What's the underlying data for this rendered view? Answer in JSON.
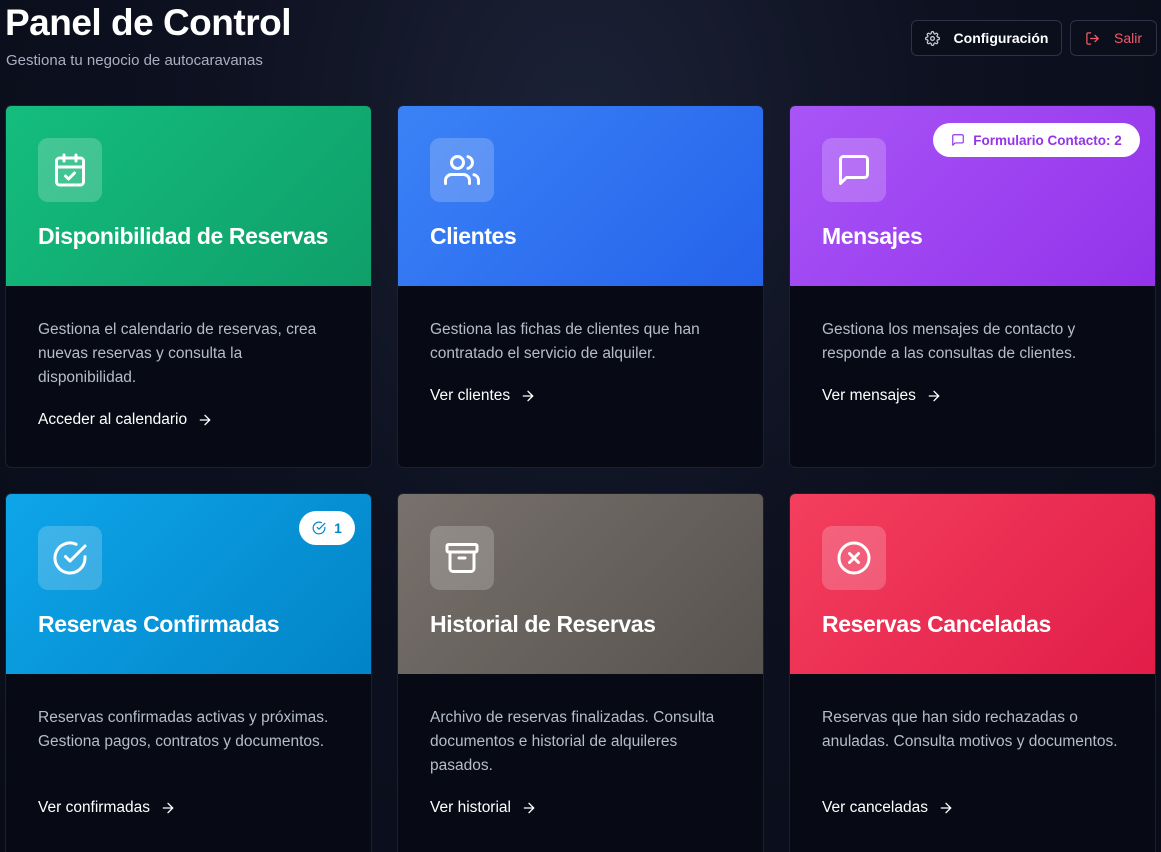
{
  "header": {
    "title": "Panel de Control",
    "subtitle": "Gestiona tu negocio de autocaravanas",
    "config_label": "Configuración",
    "exit_label": "Salir"
  },
  "cards": [
    {
      "title": "Disponibilidad de Reservas",
      "description": "Gestiona el calendario de reservas, crea nuevas reservas y consulta la disponibilidad.",
      "link": "Acceder al calendario",
      "icon": "calendar-check-icon",
      "color": "#16b57a"
    },
    {
      "title": "Clientes",
      "description": "Gestiona las fichas de clientes que han contratado el servicio de alquiler.",
      "link": "Ver clientes",
      "icon": "users-icon",
      "color": "#3272f1"
    },
    {
      "title": "Mensajes",
      "description": "Gestiona los mensajes de contacto y responde a las consultas de clientes.",
      "link": "Ver mensajes",
      "icon": "message-square-icon",
      "color": "#9d3ff0",
      "badge": "Formulario Contacto: 2"
    },
    {
      "title": "Reservas Confirmadas",
      "description": "Reservas confirmadas activas y próximas. Gestiona pagos, contratos y documentos.",
      "link": "Ver confirmadas",
      "icon": "check-circle-icon",
      "color": "#0c95d9",
      "badge": "1"
    },
    {
      "title": "Historial de Reservas",
      "description": "Archivo de reservas finalizadas. Consulta documentos e historial de alquileres pasados.",
      "link": "Ver historial",
      "icon": "archive-icon",
      "color": "#6b645e"
    },
    {
      "title": "Reservas Canceladas",
      "description": "Reservas que han sido rechazadas o anuladas. Consulta motivos y documentos.",
      "link": "Ver canceladas",
      "icon": "x-circle-icon",
      "color": "#ea2f52"
    }
  ]
}
